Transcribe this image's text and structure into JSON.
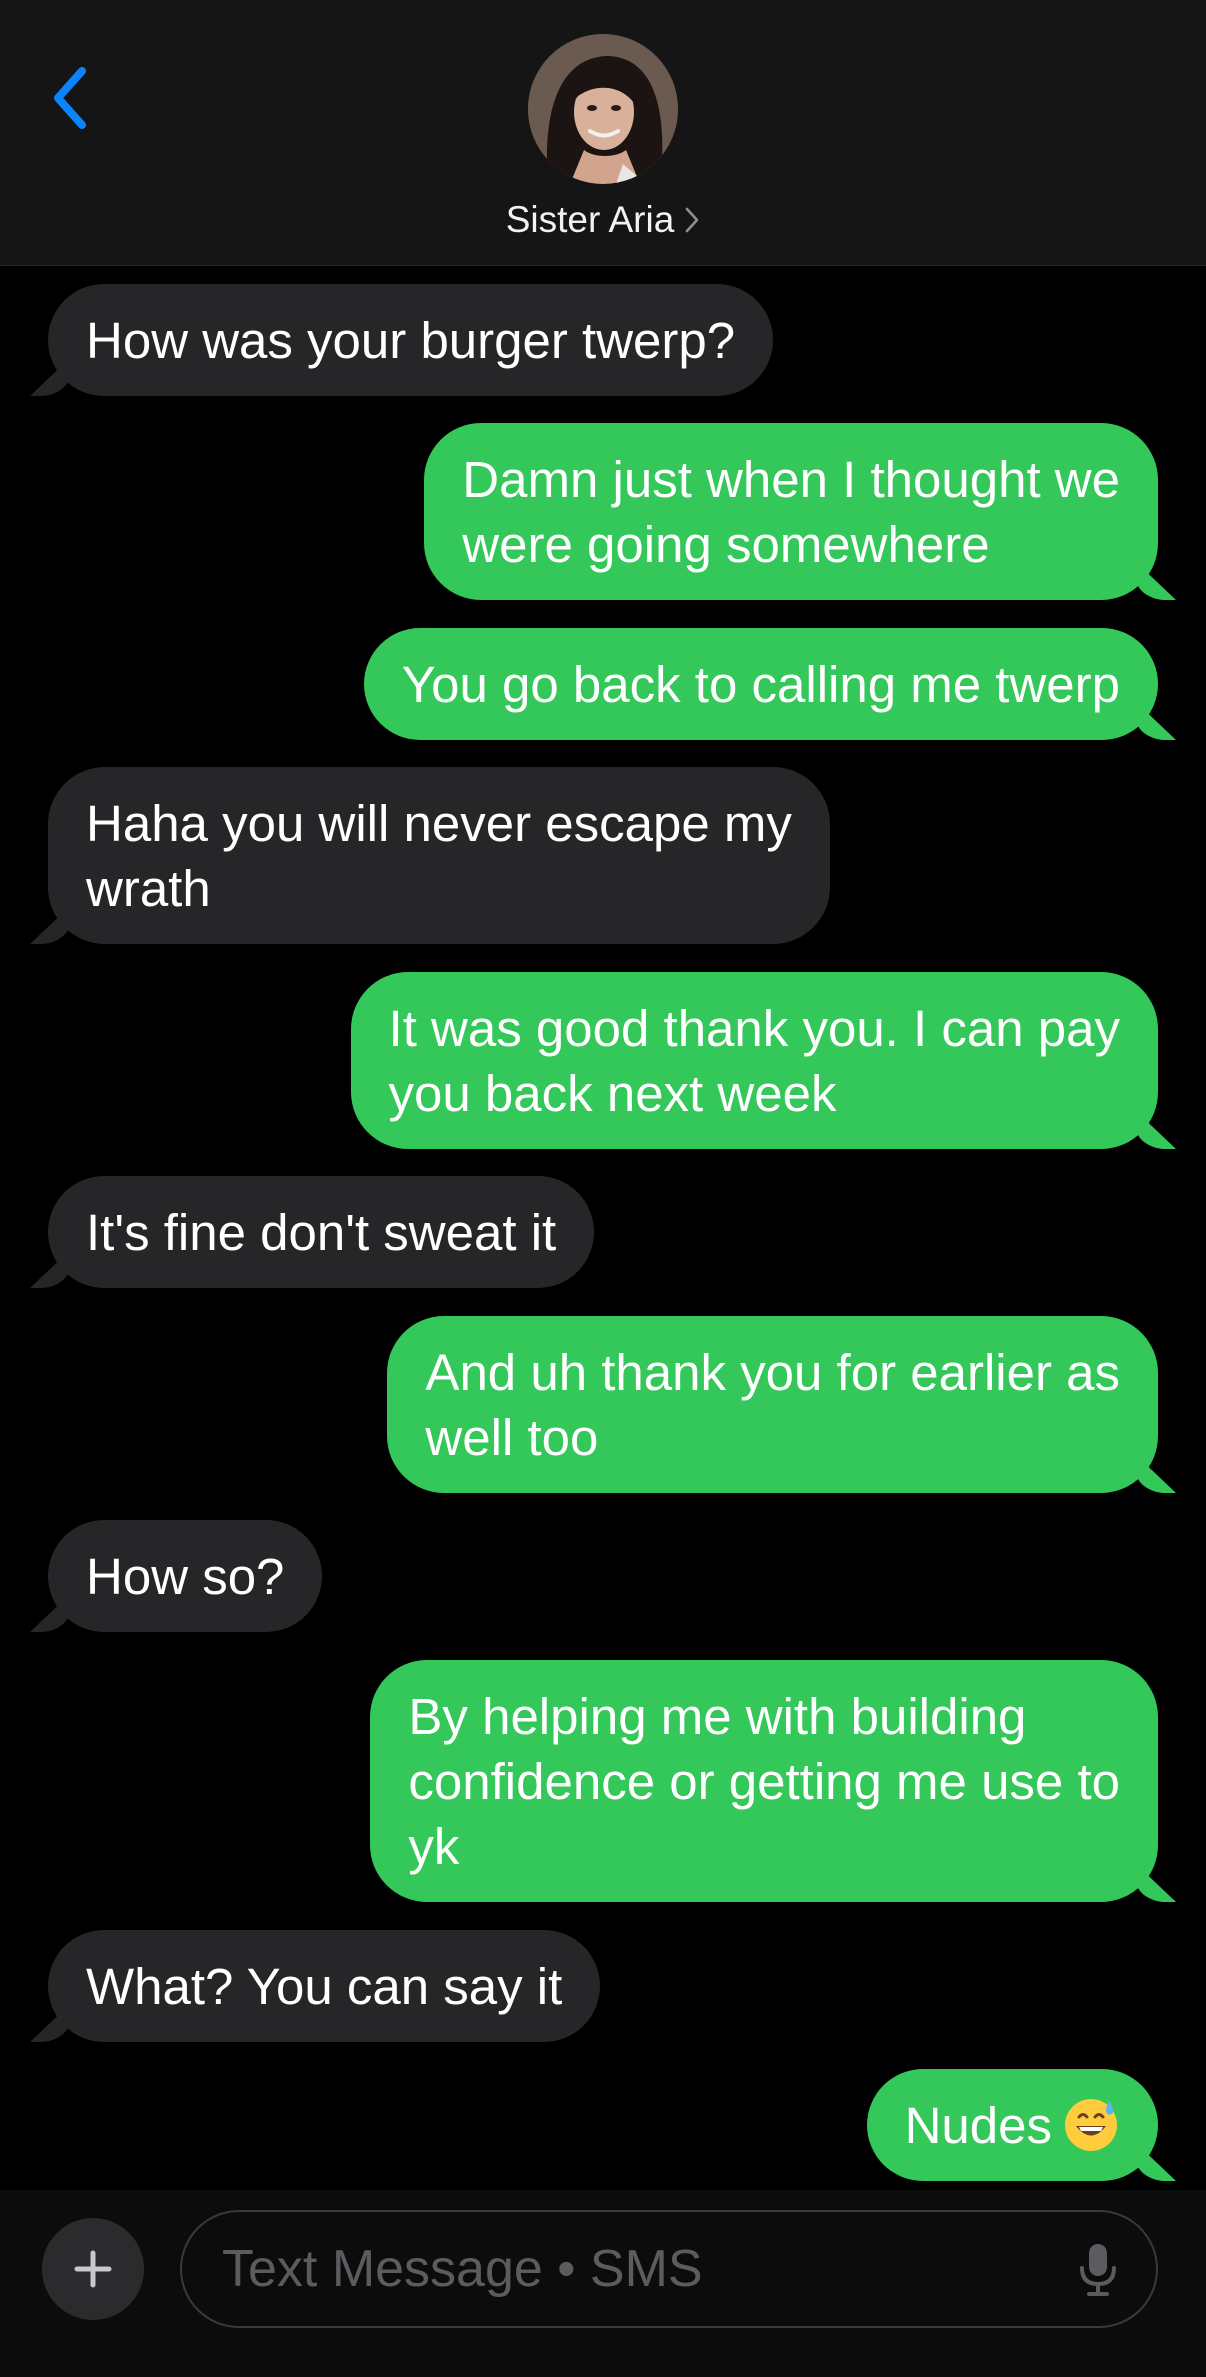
{
  "header": {
    "contact_name": "Sister Aria",
    "accent_color": "#0a84ff",
    "back_icon": "chevron-left-icon",
    "avatar": "contact-avatar-photo"
  },
  "messages": [
    {
      "from": "them",
      "lines": [
        "How was your burger twerp?"
      ]
    },
    {
      "from": "me",
      "lines": [
        "Damn just when I thought we",
        "were going somewhere"
      ]
    },
    {
      "from": "me",
      "lines": [
        "You go back to calling me twerp"
      ]
    },
    {
      "from": "them",
      "lines": [
        "Haha you will never escape my",
        "wrath"
      ]
    },
    {
      "from": "me",
      "lines": [
        "It was good thank you. I can pay",
        "you back next week"
      ]
    },
    {
      "from": "them",
      "lines": [
        "It's fine don't sweat it"
      ]
    },
    {
      "from": "me",
      "lines": [
        "And uh thank you for earlier as",
        "well too"
      ]
    },
    {
      "from": "them",
      "lines": [
        "How so?"
      ]
    },
    {
      "from": "me",
      "lines": [
        "By helping me with building",
        "confidence or getting me use to",
        "yk"
      ]
    },
    {
      "from": "them",
      "lines": [
        "What? You can say it"
      ]
    },
    {
      "from": "me",
      "lines": [
        "Nudes"
      ],
      "emoji": "grinning-face-with-sweat-emoji"
    }
  ],
  "colors": {
    "incoming_bubble": "#262629",
    "outgoing_bubble": "#34c759",
    "background": "#000000"
  },
  "composer": {
    "placeholder": "Text Message • SMS",
    "plus_icon": "plus-icon",
    "mic_icon": "microphone-icon"
  }
}
